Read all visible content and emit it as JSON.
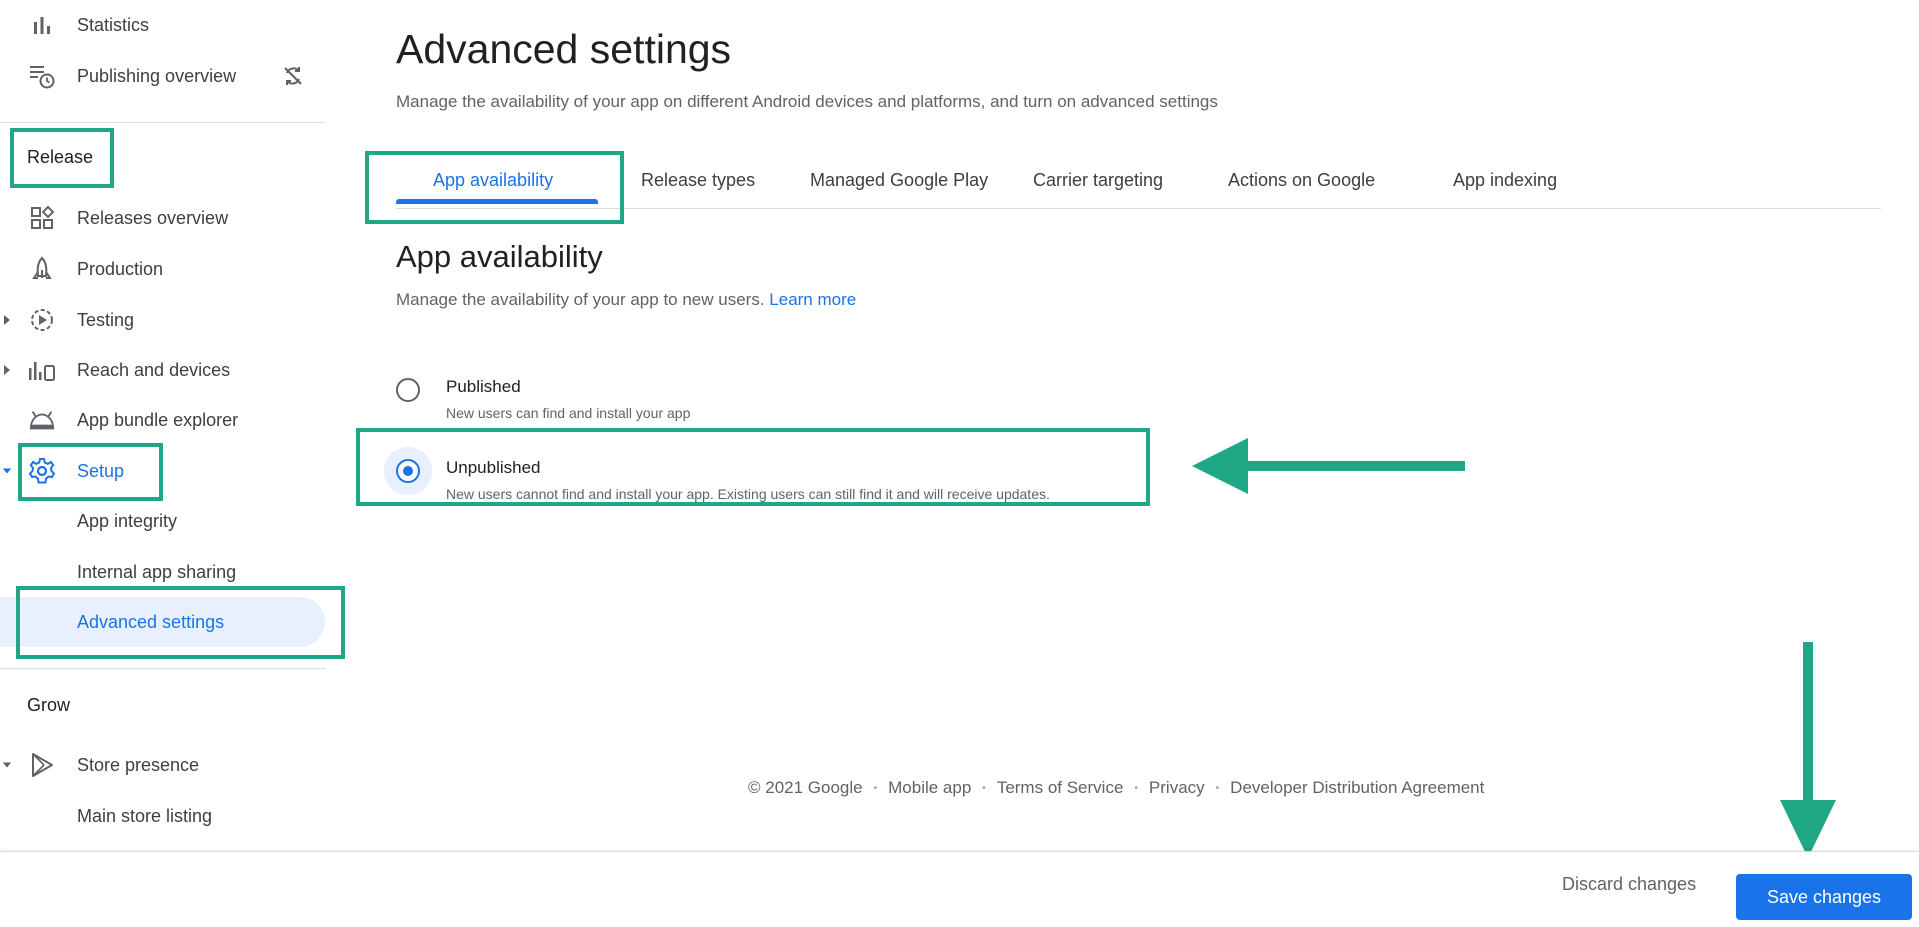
{
  "colors": {
    "accent": "#1a73e8",
    "highlight": "#1fa786",
    "selected_bg": "#e8f0fe"
  },
  "sidebar": {
    "items": [
      {
        "label": "Statistics",
        "icon": "bar-chart-icon"
      },
      {
        "label": "Publishing overview",
        "icon": "publishing-clock-icon"
      }
    ],
    "release_heading": "Release",
    "release_items": [
      {
        "label": "Releases overview",
        "icon": "dashboard-icon"
      },
      {
        "label": "Production",
        "icon": "rocket-icon"
      },
      {
        "label": "Testing",
        "icon": "play-circle-icon"
      },
      {
        "label": "Reach and devices",
        "icon": "devices-chart-icon"
      },
      {
        "label": "App bundle explorer",
        "icon": "android-icon"
      },
      {
        "label": "Setup",
        "icon": "gear-icon"
      },
      {
        "label": "App integrity"
      },
      {
        "label": "Internal app sharing"
      },
      {
        "label": "Advanced settings"
      }
    ],
    "grow_heading": "Grow",
    "grow_items": [
      {
        "label": "Store presence",
        "icon": "play-store-icon"
      },
      {
        "label": "Main store listing"
      }
    ]
  },
  "page": {
    "title": "Advanced settings",
    "description": "Manage the availability of your app on different Android devices and platforms, and turn on advanced settings"
  },
  "tabs": [
    {
      "label": "App availability",
      "active": true
    },
    {
      "label": "Release types"
    },
    {
      "label": "Managed Google Play"
    },
    {
      "label": "Carrier targeting"
    },
    {
      "label": "Actions on Google"
    },
    {
      "label": "App indexing"
    }
  ],
  "section": {
    "title": "App availability",
    "description": "Manage the availability of your app to new users.",
    "learn_more": "Learn more"
  },
  "options": [
    {
      "label": "Published",
      "help": "New users can find and install your app",
      "selected": false
    },
    {
      "label": "Unpublished",
      "help": "New users cannot find and install your app. Existing users can still find it and will receive updates.",
      "selected": true
    }
  ],
  "footer": {
    "copyright": "© 2021 Google",
    "links": [
      "Mobile app",
      "Terms of Service",
      "Privacy",
      "Developer Distribution Agreement"
    ]
  },
  "actions": {
    "discard": "Discard changes",
    "save": "Save changes"
  }
}
